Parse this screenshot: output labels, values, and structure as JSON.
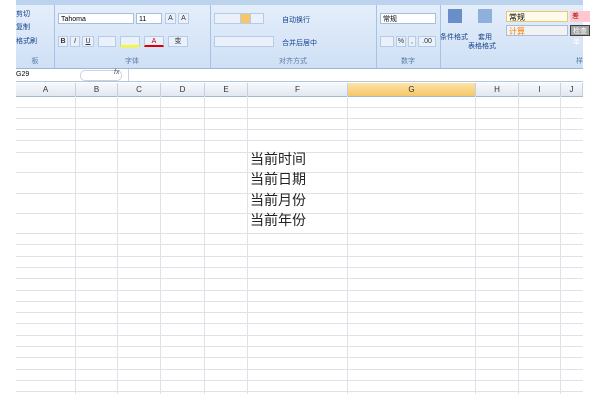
{
  "ribbon": {
    "clipboard": {
      "cut": "剪切",
      "copy": "复制",
      "format_painter": "格式刷",
      "label": "板"
    },
    "font": {
      "name": "Tahoma",
      "size": "11",
      "label": "字体",
      "bold": "B",
      "italic": "I",
      "underline": "U",
      "grow": "A",
      "shrink": "A",
      "font_color": "A",
      "phonetic": "变"
    },
    "alignment": {
      "wrap": "自动换行",
      "merge": "合并后居中",
      "label": "对齐方式"
    },
    "number": {
      "format": "常规",
      "percent": "%",
      "comma": ",",
      "inc": ".00",
      "dec": ".0",
      "label": "数字"
    },
    "styles": {
      "conditional": "条件格式",
      "table_format_1": "套用",
      "table_format_2": "表格格式",
      "normal": "常规",
      "bad": "差",
      "calc": "计算",
      "check": "检查单",
      "label": "样"
    }
  },
  "formula_bar": {
    "name_box": "G29",
    "fx": "fx",
    "value": ""
  },
  "columns": [
    "A",
    "B",
    "C",
    "D",
    "E",
    "F",
    "G",
    "H",
    "I",
    "J"
  ],
  "selected_column": "G",
  "cells": {
    "F6": "当前时间",
    "F7": "当前日期",
    "F8": "当前月份",
    "F9": "当前年份"
  }
}
